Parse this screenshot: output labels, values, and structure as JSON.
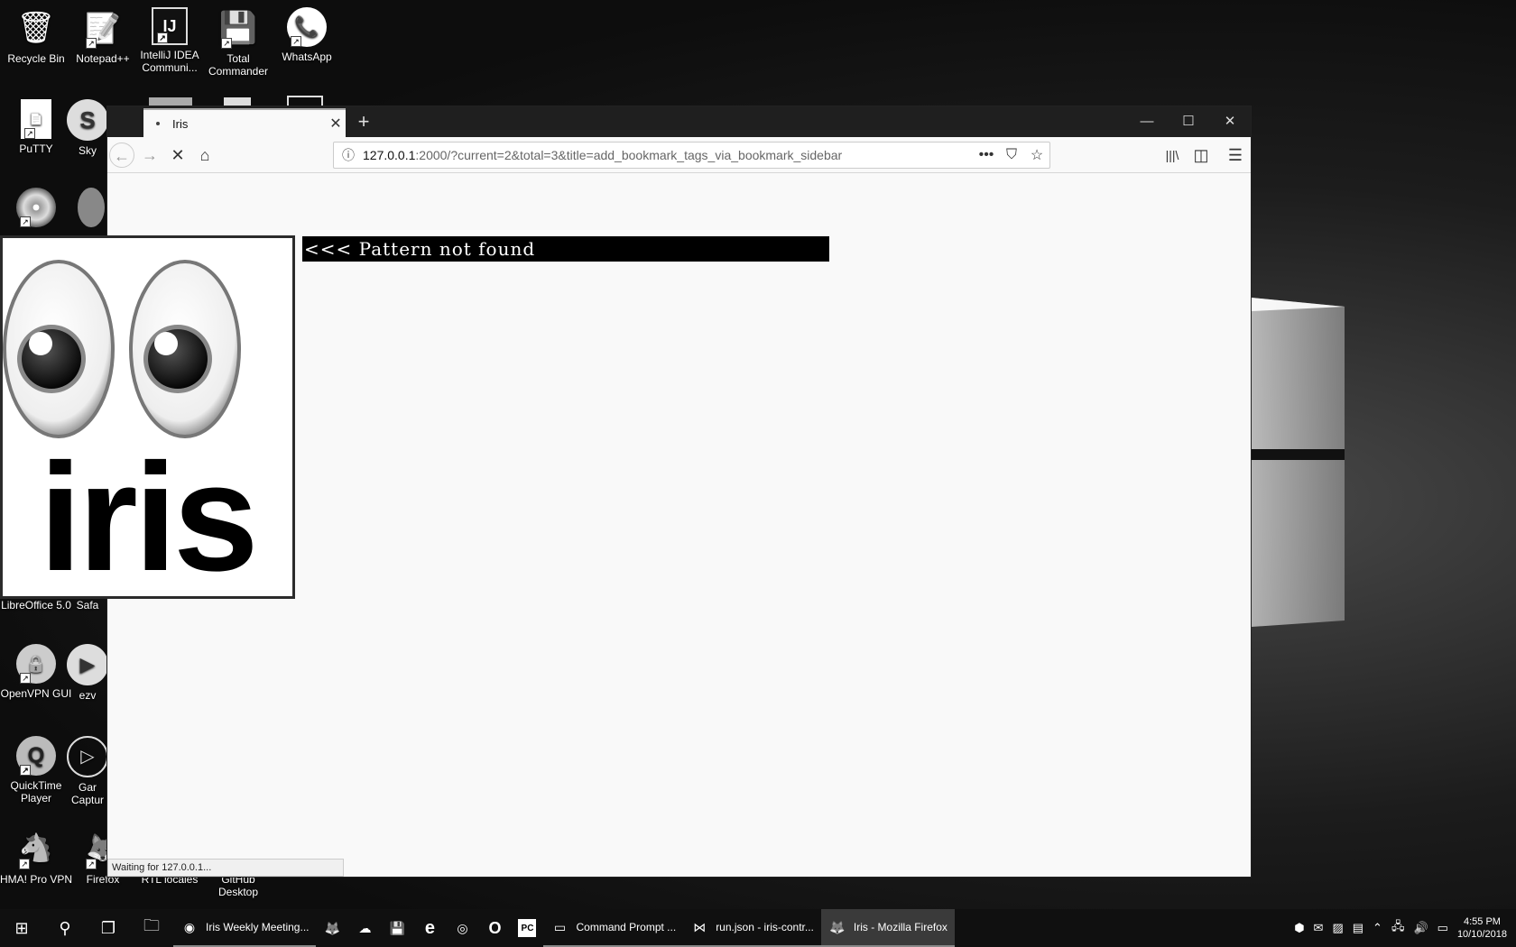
{
  "desktop": {
    "icons": [
      {
        "label": "Recycle Bin",
        "glyph": "🗑"
      },
      {
        "label": "Notepad++",
        "glyph": "📝"
      },
      {
        "label": "IntelliJ IDEA Communi...",
        "glyph": "IJ"
      },
      {
        "label": "Total Commander",
        "glyph": "💾"
      },
      {
        "label": "WhatsApp",
        "glyph": "📞"
      },
      {
        "label": "PuTTY",
        "glyph": "📄"
      },
      {
        "label": "Sky",
        "glyph": "S"
      },
      {
        "label": "LibreOffice 5.0",
        "glyph": ""
      },
      {
        "label": "Safa",
        "glyph": ""
      },
      {
        "label": "OpenVPN GUI",
        "glyph": "🔒"
      },
      {
        "label": "ezv",
        "glyph": "▶"
      },
      {
        "label": "QuickTime Player",
        "glyph": "Q"
      },
      {
        "label": "Gar Captur",
        "glyph": "▷"
      },
      {
        "label": "HMA! Pro VPN",
        "glyph": "🐴"
      },
      {
        "label": "Firefox",
        "glyph": "🦊"
      },
      {
        "label": "RTL locales",
        "glyph": ""
      },
      {
        "label": "GitHub Desktop",
        "glyph": ""
      }
    ]
  },
  "browser": {
    "tab_title": "Iris",
    "tab_close": "✕",
    "new_tab": "+",
    "win_min": "—",
    "win_max": "☐",
    "win_close": "✕",
    "back": "←",
    "forward": "→",
    "stop": "✕",
    "home": "⌂",
    "url_host": "127.0.0.1",
    "url_rest": ":2000/?current=2&total=3&title=add_bookmark_tags_via_bookmark_sidebar",
    "page_actions": "•••",
    "pocket": "⛉",
    "bookmark_star": "☆",
    "library": "|||\\",
    "sidebar": "◫",
    "menu": "☰",
    "status_text": "Waiting for 127.0.0.1..."
  },
  "overlay": {
    "pattern_message": "<<< Pattern not found",
    "logo_text": "iris"
  },
  "taskbar": {
    "start": "⊞",
    "search": "⚲",
    "task_view": "❐",
    "explorer": "🗀",
    "apps": [
      {
        "label": "Iris Weekly Meeting...",
        "icon": "◉",
        "active": false
      },
      {
        "label": "",
        "icon": "🦊",
        "active": false
      },
      {
        "label": "",
        "icon": "☁",
        "active": false
      },
      {
        "label": "",
        "icon": "💾",
        "active": false
      },
      {
        "label": "",
        "icon": "e",
        "active": false
      },
      {
        "label": "",
        "icon": "◎",
        "active": false
      },
      {
        "label": "",
        "icon": "O",
        "active": false
      },
      {
        "label": "",
        "icon": "PC",
        "active": false
      },
      {
        "label": "Command Prompt ...",
        "icon": "▭",
        "active": false
      },
      {
        "label": "run.json - iris-contr...",
        "icon": "⋈",
        "active": false
      },
      {
        "label": "Iris - Mozilla Firefox",
        "icon": "🦊",
        "active": true
      }
    ],
    "clock_time": "4:55 PM",
    "clock_date": "10/10/2018"
  }
}
